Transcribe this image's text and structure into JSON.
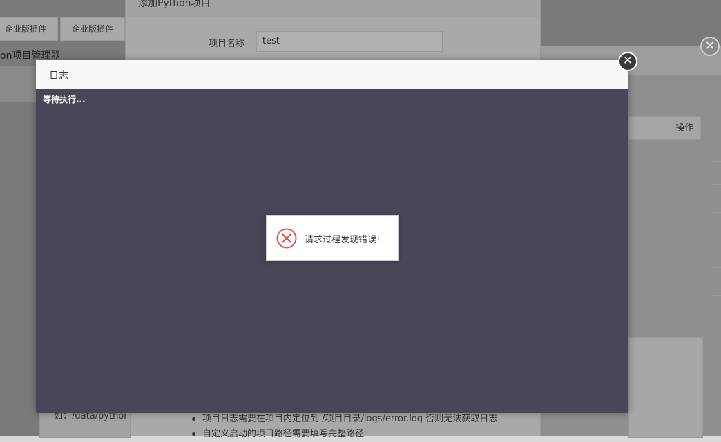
{
  "background": {
    "tabs": [
      "企业版插件",
      "企业版插件"
    ],
    "panel_title": "on项目管理器",
    "operation_header": "操作",
    "path_text": "如：/data/python",
    "tips": [
      "项目日志需要在项目内定位到 /项目目录/logs/error.log 否则无法获取日志",
      "自定义启动的项目路径需要填写完整路径"
    ]
  },
  "add_dialog": {
    "title": "添加Python项目",
    "project_name_label": "项目名称",
    "project_name_value": "test"
  },
  "log_dialog": {
    "title": "日志",
    "log_text": "等待执行..."
  },
  "toast": {
    "message": "请求过程发现错误!",
    "icon": "error-circle-icon",
    "icon_color": "#d9534f"
  },
  "icons": {
    "close": "close-icon"
  }
}
